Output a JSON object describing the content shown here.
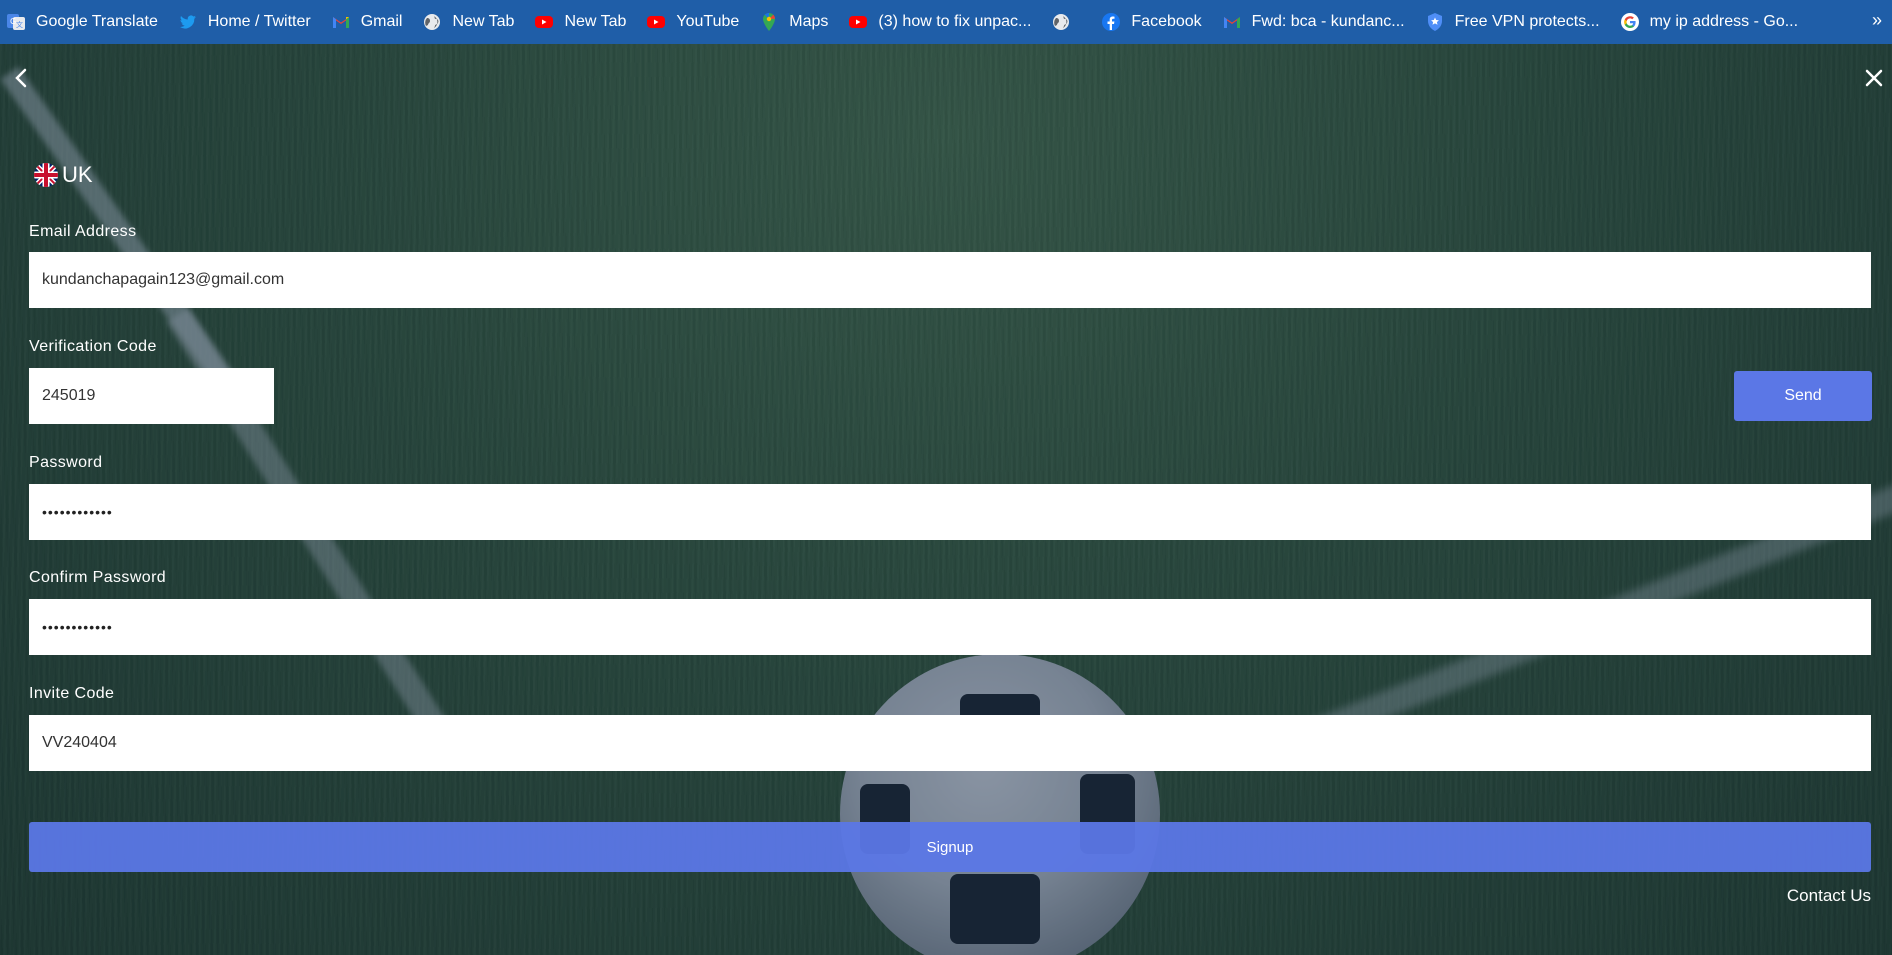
{
  "bookmarks": [
    {
      "label": "Google Translate",
      "icon": "google-translate-icon"
    },
    {
      "label": "Home / Twitter",
      "icon": "twitter-icon"
    },
    {
      "label": "Gmail",
      "icon": "gmail-icon"
    },
    {
      "label": "New Tab",
      "icon": "globe-icon"
    },
    {
      "label": "New Tab",
      "icon": "youtube-icon"
    },
    {
      "label": "YouTube",
      "icon": "youtube-icon"
    },
    {
      "label": "Maps",
      "icon": "maps-icon"
    },
    {
      "label": "(3) how to fix unpac...",
      "icon": "youtube-icon"
    },
    {
      "label": "",
      "icon": "globe-icon"
    },
    {
      "label": "Facebook",
      "icon": "facebook-icon"
    },
    {
      "label": "Fwd: bca - kundanc...",
      "icon": "gmail-icon"
    },
    {
      "label": "Free VPN protects...",
      "icon": "shield-star-icon"
    },
    {
      "label": "my ip address - Go...",
      "icon": "google-icon"
    }
  ],
  "bookmarks_more": "»",
  "region": {
    "label": "UK",
    "icon": "uk-flag-icon"
  },
  "form": {
    "email_label": "Email Address",
    "email_value": "kundanchapagain123@gmail.com",
    "code_label": "Verification Code",
    "code_value": "245019",
    "send_label": "Send",
    "password_label": "Password",
    "password_value": "••••••••••••",
    "confirm_label": "Confirm Password",
    "confirm_value": "••••••••••••",
    "invite_label": "Invite Code",
    "invite_value": "VV240404",
    "signup_label": "Signup"
  },
  "contact_label": "Contact Us",
  "colors": {
    "bookmark_bar": "#1f5ea8",
    "accent_button": "#5b77e6",
    "field_bg": "#ffffff"
  }
}
